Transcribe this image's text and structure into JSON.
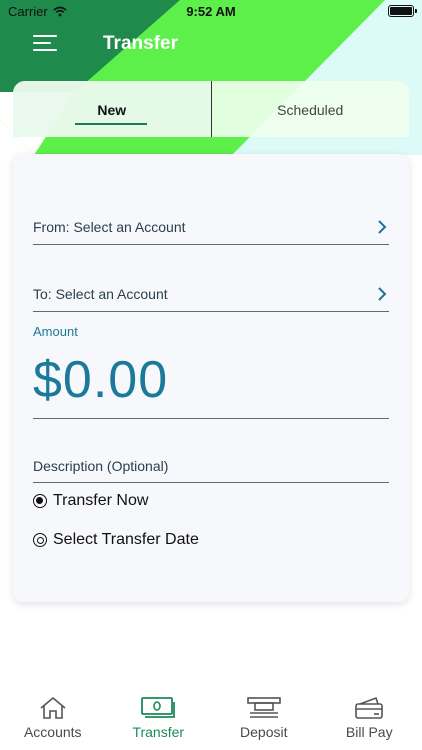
{
  "status_bar": {
    "carrier": "Carrier",
    "time": "9:52 AM"
  },
  "nav": {
    "title": "Transfer"
  },
  "tabs": [
    {
      "label": "New",
      "selected": true
    },
    {
      "label": "Scheduled",
      "selected": false
    }
  ],
  "form": {
    "from_label": "From: Select an Account",
    "to_label": "To: Select an Account",
    "amount_label": "Amount",
    "amount_value": "$0.00",
    "description_placeholder": "Description (Optional)",
    "options": [
      {
        "label": "Transfer Now",
        "selected": true
      },
      {
        "label": "Select Transfer Date",
        "selected": false
      }
    ]
  },
  "tabbar": {
    "items": [
      {
        "label": "Accounts",
        "icon": "home-icon",
        "active": false
      },
      {
        "label": "Transfer",
        "icon": "cash-icon",
        "active": true
      },
      {
        "label": "Deposit",
        "icon": "deposit-icon",
        "active": false
      },
      {
        "label": "Bill Pay",
        "icon": "wallet-icon",
        "active": false
      }
    ]
  },
  "colors": {
    "header_dark_green": "#1e8a4c",
    "header_bright_green": "#5ef04a",
    "header_light_cyan": "#dcfaf7",
    "accent_teal": "#1b7a9a",
    "active_tab_green": "#1b8a5a"
  }
}
